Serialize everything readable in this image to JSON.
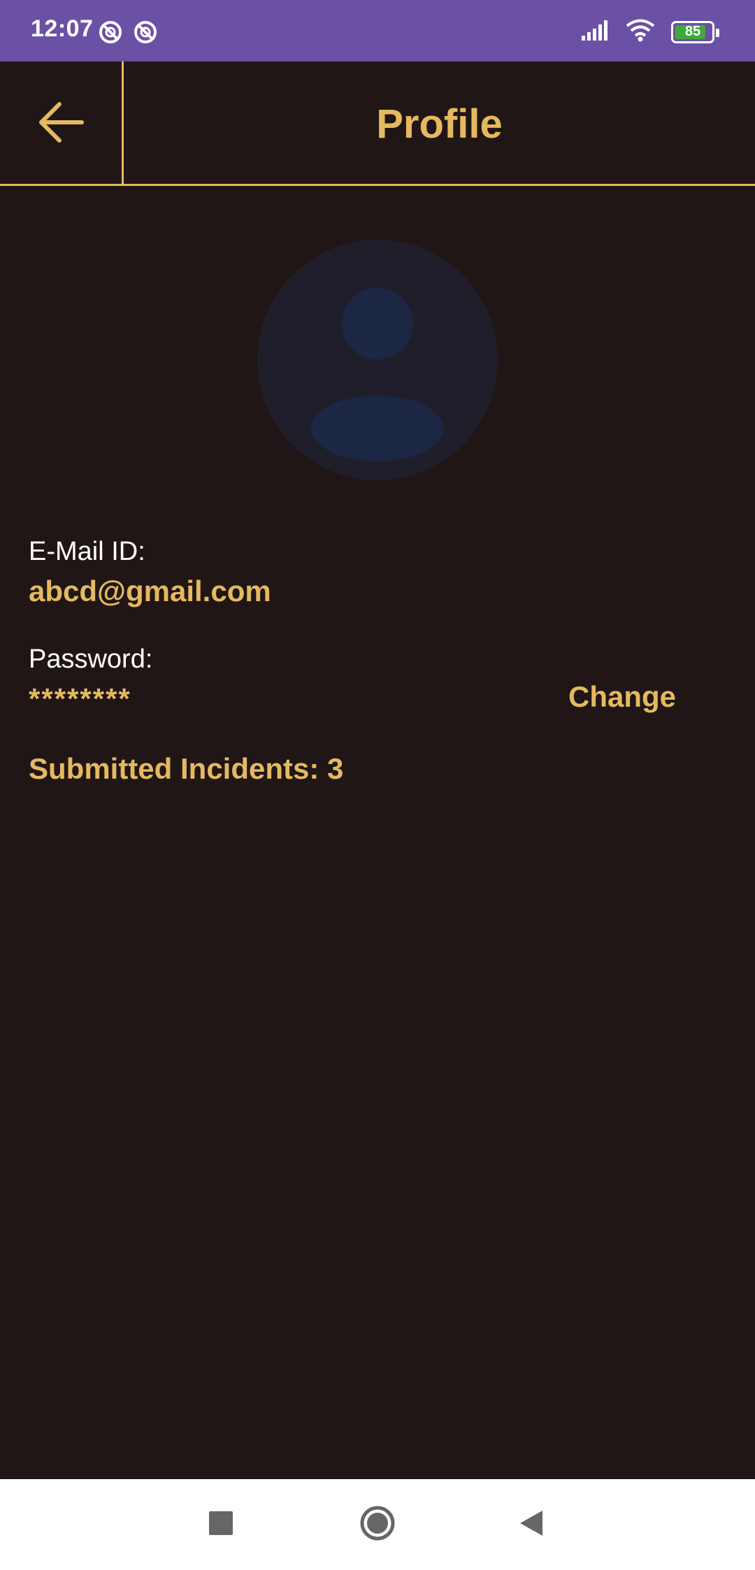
{
  "status_bar": {
    "time": "12:07",
    "battery_level": "85",
    "battery_fraction": 0.85,
    "colors": {
      "background": "#6a51a6",
      "battery": "#3fa93a"
    },
    "icons": [
      "do-not-disturb-icon",
      "do-not-disturb-icon",
      "signal-icon",
      "wifi-icon",
      "battery-icon"
    ]
  },
  "header": {
    "title": "Profile",
    "back_icon": "arrow-left-icon"
  },
  "profile": {
    "avatar_icon": "person-avatar-icon",
    "email_label": "E-Mail ID:",
    "email_value": "abcd@gmail.com",
    "password_label": "Password:",
    "password_value": "********",
    "change_label": "Change",
    "incidents_text": "Submitted Incidents: 3"
  },
  "nav_bar": {
    "recents_icon": "square-icon",
    "home_icon": "circle-icon",
    "back_icon": "triangle-back-icon"
  },
  "theme": {
    "background": "#211616",
    "accent": "#e5b95f",
    "text": "#ffffff"
  }
}
